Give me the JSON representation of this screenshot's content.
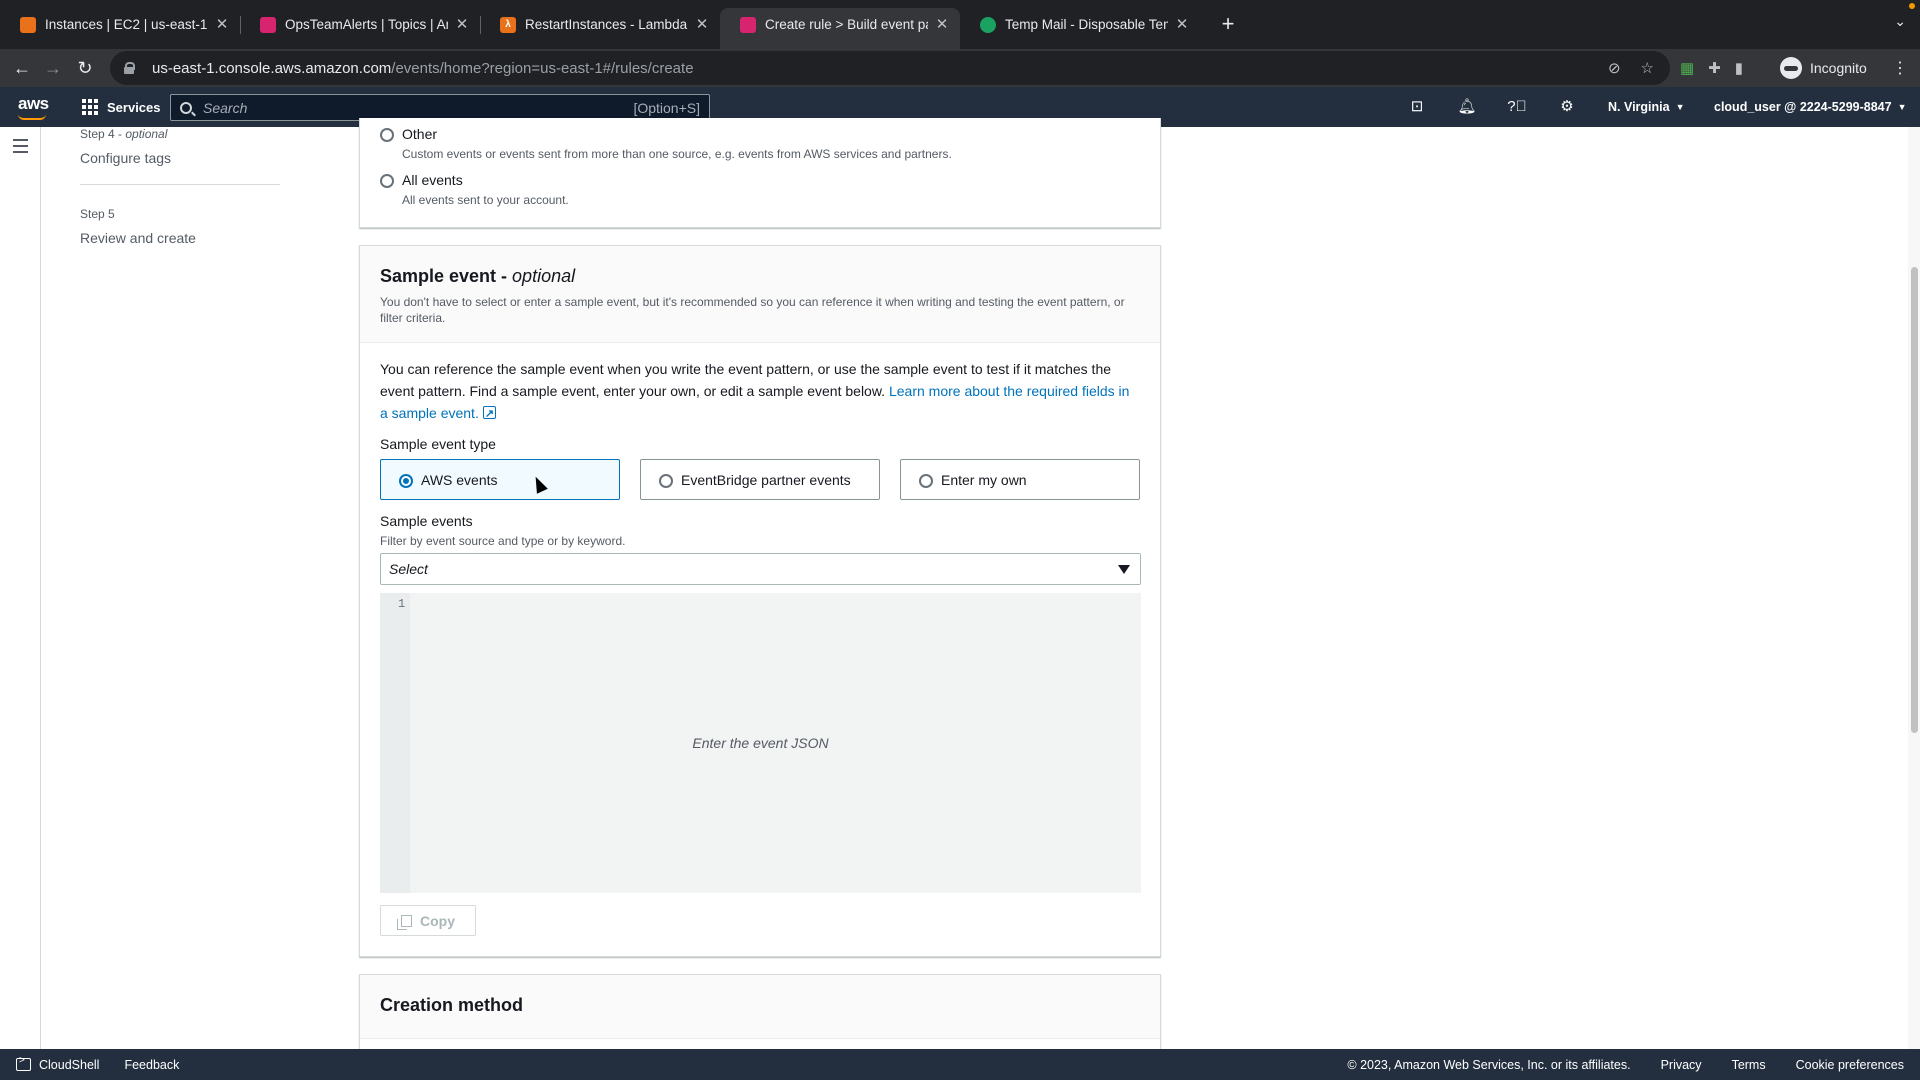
{
  "browser": {
    "tabs": [
      {
        "title": "Instances | EC2 | us-east-1",
        "favicon": "ec2-favicon",
        "favicon_color": "#e8711a",
        "active": false
      },
      {
        "title": "OpsTeamAlerts | Topics | Ama",
        "favicon": "sns-favicon",
        "favicon_color": "#d6246e",
        "active": false
      },
      {
        "title": "RestartInstances - Lambda",
        "favicon": "lambda-favicon",
        "favicon_color": "#e8711a",
        "active": false
      },
      {
        "title": "Create rule > Build event patte",
        "favicon": "eventbridge-favicon",
        "favicon_color": "#d6246e",
        "active": true
      },
      {
        "title": "Temp Mail - Disposable Tempo",
        "favicon": "tempmail-favicon",
        "favicon_color": "#1aa260",
        "active": false
      }
    ],
    "url_host": "us-east-1.console.aws.amazon.com",
    "url_path": "/events/home?region=us-east-1#/rules/create",
    "profile_label": "Incognito"
  },
  "aws_nav": {
    "logo": "aws",
    "services_label": "Services",
    "search_placeholder": "Search",
    "search_shortcut": "[Option+S]",
    "region": "N. Virginia",
    "account": "cloud_user @ 2224-5299-8847"
  },
  "sidenav": {
    "step4_label": "Step 4 - ",
    "step4_optional": "optional",
    "step4_name": "Configure tags",
    "step5_label": "Step 5",
    "step5_name": "Review and create"
  },
  "event_source": {
    "other_title": "Other",
    "other_desc": "Custom events or events sent from more than one source, e.g. events from AWS services and partners.",
    "all_title": "All events",
    "all_desc": "All events sent to your account."
  },
  "sample_event": {
    "title": "Sample event - ",
    "title_optional": "optional",
    "description": "You don't have to select or enter a sample event, but it's recommended so you can reference it when writing and testing the event pattern, or filter criteria.",
    "intro": "You can reference the sample event when you write the event pattern, or use the sample event to test if it matches the event pattern. Find a sample event, enter your own, or edit a sample event below. ",
    "learn_more": "Learn more about the required fields in a sample event.",
    "type_label": "Sample event type",
    "type_options": [
      "AWS events",
      "EventBridge partner events",
      "Enter my own"
    ],
    "type_selected": "AWS events",
    "sample_events_label": "Sample events",
    "sample_events_hint": "Filter by event source and type or by keyword.",
    "select_placeholder": "Select",
    "editor_line": "1",
    "editor_placeholder": "Enter the event JSON",
    "copy_label": "Copy"
  },
  "creation_method": {
    "title": "Creation method"
  },
  "footer": {
    "cloudshell": "CloudShell",
    "feedback": "Feedback",
    "copyright": "© 2023, Amazon Web Services, Inc. or its affiliates.",
    "privacy": "Privacy",
    "terms": "Terms",
    "cookie": "Cookie preferences"
  },
  "colors": {
    "aws_nav": "#232f3e",
    "link": "#0073bb",
    "selected_tile": "#f1faff",
    "aws_orange": "#ff9900"
  }
}
